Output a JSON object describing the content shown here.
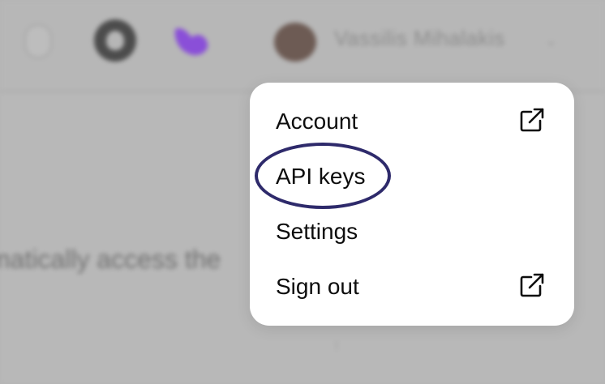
{
  "background": {
    "user_name": "Vassilis Mihalakis",
    "body_text": "matically access the"
  },
  "menu": {
    "items": [
      {
        "label": "Account",
        "icon": "external-link-icon"
      },
      {
        "label": "API keys",
        "icon": ""
      },
      {
        "label": "Settings",
        "icon": ""
      },
      {
        "label": "Sign out",
        "icon": "external-link-icon"
      }
    ]
  },
  "colors": {
    "overlay": "#b8b8b8",
    "menu_bg": "#ffffff",
    "text": "#0d0d0d",
    "highlight_ring": "#2e2a6b",
    "brand_purple": "#8a4fd8"
  }
}
